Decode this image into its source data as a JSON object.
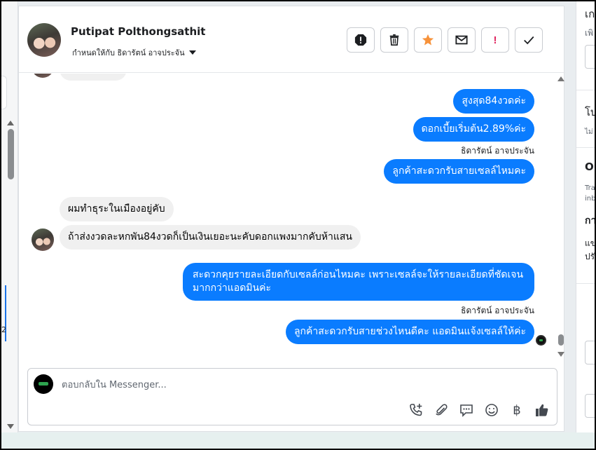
{
  "header": {
    "contact_name": "Putipat Polthongsathit",
    "assigned_to": "กำหนดให้กับ ธิดารัตน์ อาจประจัน"
  },
  "actions": [
    {
      "name": "spam-icon"
    },
    {
      "name": "trash-icon"
    },
    {
      "name": "star-icon"
    },
    {
      "name": "mail-icon"
    },
    {
      "name": "exclamation-icon",
      "label": "!"
    },
    {
      "name": "check-icon"
    }
  ],
  "messages": [
    {
      "dir": "out",
      "text": "สูงสุด84งวดค่ะ"
    },
    {
      "dir": "out",
      "text": "ดอกเบี้ยเริ่มต้น2.89%ค่ะ"
    },
    {
      "dir": "sender",
      "text": "ธิดารัตน์ อาจประจัน"
    },
    {
      "dir": "out",
      "text": "ลูกค้าสะดวกรับสายเซลล์ไหมคะ"
    },
    {
      "dir": "in",
      "text": "ผมทำธุระในเมืองอยู่คับ"
    },
    {
      "dir": "in",
      "text": "ถ้าส่งงวดละหกพัน84งวดก็เป็นเงินเยอะนะคับดอกแพงมากคับห้าแสน"
    },
    {
      "dir": "out",
      "text": "สะดวกคุยรายละเอียดกับเซลล์ก่อนไหมคะ เพราะเซลล์จะให้รายละเอียดที่ชัดเจนมากกว่าแอดมินค่ะ"
    },
    {
      "dir": "sender",
      "text": "ธิดารัตน์ อาจประจัน"
    },
    {
      "dir": "out",
      "text": "ลูกค้าสะดวกรับสายช่วงไหนดีคะ แอดมินแจ้งเซลล์ให้ค่ะ"
    }
  ],
  "composer": {
    "placeholder": "ตอบกลับใน Messenger..."
  },
  "tools": [
    {
      "name": "call-add-icon"
    },
    {
      "name": "attachment-icon"
    },
    {
      "name": "saved-reply-icon"
    },
    {
      "name": "emoji-icon"
    },
    {
      "name": "payment-icon",
      "label": "฿"
    },
    {
      "name": "like-icon"
    }
  ],
  "right_panel": {
    "l1": "เก",
    "l2": "เพิ",
    "l3": "โบ",
    "l4": "ไม่",
    "l5": "Ou",
    "l6": "Tra",
    "l7": "inb",
    "l8": "กา",
    "l9": "แข",
    "l10": "ปรั"
  },
  "left_panel": {
    "digit": "2"
  },
  "colors": {
    "outgoing": "#0a7cff",
    "incoming": "#f0f0f0",
    "star": "#f7923a"
  }
}
